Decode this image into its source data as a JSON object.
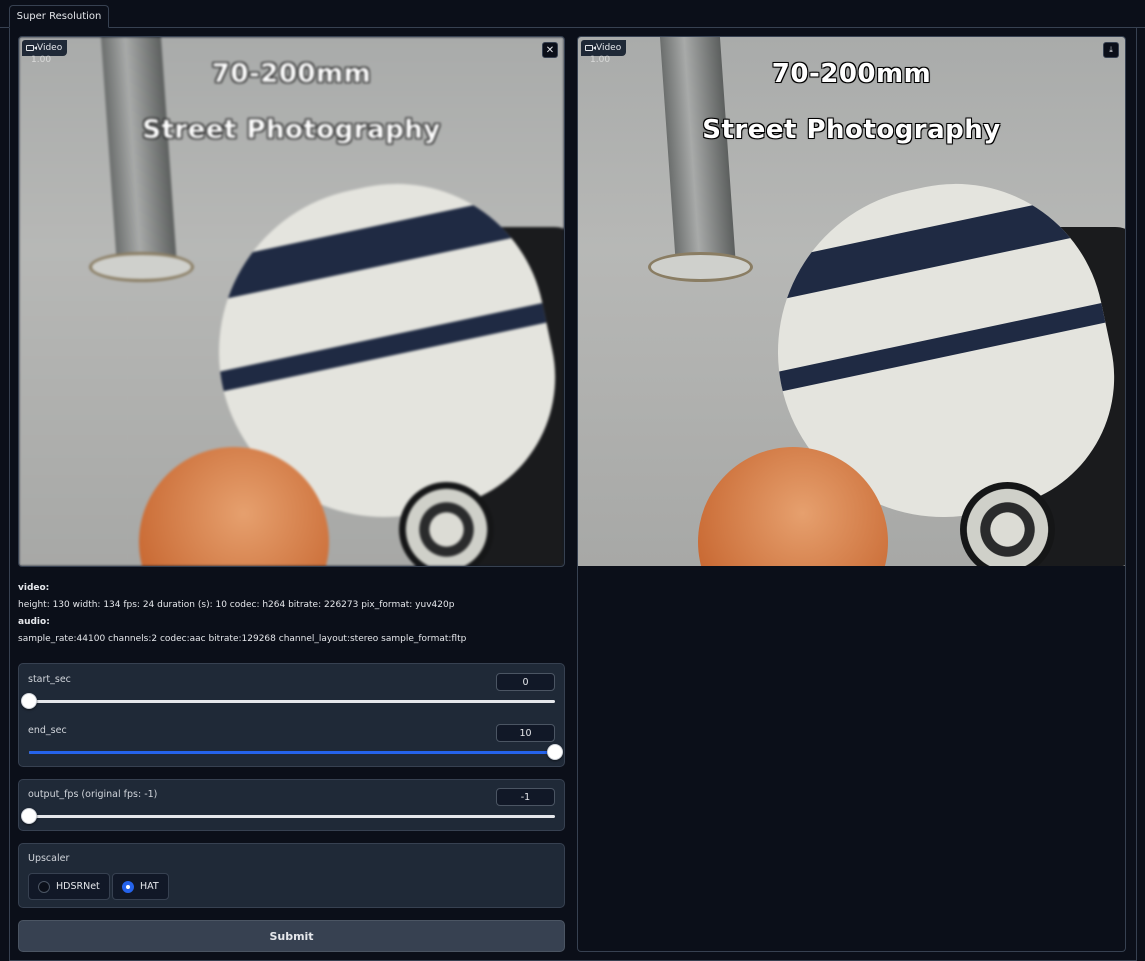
{
  "tabs": [
    {
      "label": "Super Resolution",
      "active": true
    }
  ],
  "input_video": {
    "label": "Video",
    "speed": "1.00",
    "overlay_line1": "70-200mm",
    "overlay_line2": "Street Photography",
    "clear_icon": "close-icon"
  },
  "output_video": {
    "label": "Video",
    "speed": "1.00",
    "overlay_line1": "70-200mm",
    "overlay_line2": "Street Photography",
    "download_icon": "download-icon"
  },
  "info": {
    "video_key": "video:",
    "video_details": "height: 130 width: 134 fps: 24 duration (s): 10 codec: h264 bitrate: 226273 pix_format: yuv420p",
    "audio_key": "audio:",
    "audio_details": "sample_rate:44100 channels:2 codec:aac bitrate:129268 channel_layout:stereo sample_format:fltp"
  },
  "sliders": {
    "start_sec": {
      "label": "start_sec",
      "value": "0",
      "fraction": 0
    },
    "end_sec": {
      "label": "end_sec",
      "value": "10",
      "fraction": 1
    },
    "output_fps": {
      "label": "output_fps (original fps: -1)",
      "value": "-1",
      "fraction": 0
    }
  },
  "upscaler": {
    "label": "Upscaler",
    "options": [
      {
        "label": "HDSRNet",
        "selected": false
      },
      {
        "label": "HAT",
        "selected": true
      }
    ]
  },
  "submit_label": "Submit",
  "colors": {
    "accent": "#2563eb",
    "background": "#0b0f19",
    "panel": "#1f2937",
    "border": "#374151"
  }
}
